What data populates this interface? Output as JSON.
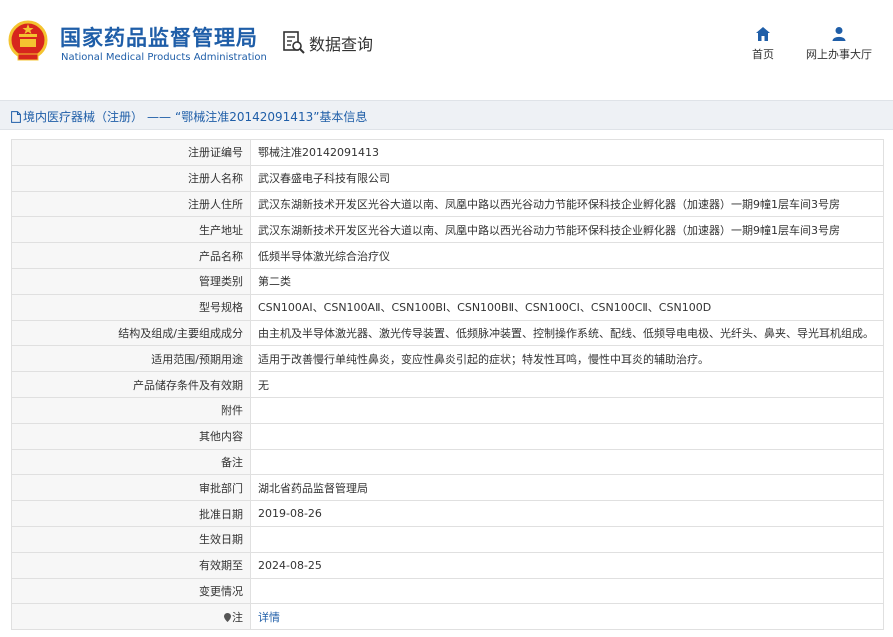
{
  "header": {
    "title_cn": "国家药品监督管理局",
    "title_en": "National Medical Products Administration",
    "query_label": "数据查询",
    "nav": [
      {
        "label": "首页",
        "icon": "home-icon"
      },
      {
        "label": "网上办事大厅",
        "icon": "user-icon"
      }
    ]
  },
  "breadcrumb": {
    "category": "境内医疗器械（注册）",
    "separator": "——",
    "title": "“鄂械注准20142091413”基本信息"
  },
  "detail": {
    "rows": [
      {
        "label": "注册证编号",
        "value": "鄂械注准20142091413"
      },
      {
        "label": "注册人名称",
        "value": "武汉春盛电子科技有限公司"
      },
      {
        "label": "注册人住所",
        "value": "武汉东湖新技术开发区光谷大道以南、凤凰中路以西光谷动力节能环保科技企业孵化器（加速器）一期9幢1层车间3号房"
      },
      {
        "label": "生产地址",
        "value": "武汉东湖新技术开发区光谷大道以南、凤凰中路以西光谷动力节能环保科技企业孵化器（加速器）一期9幢1层车间3号房"
      },
      {
        "label": "产品名称",
        "value": "低频半导体激光综合治疗仪"
      },
      {
        "label": "管理类别",
        "value": "第二类"
      },
      {
        "label": "型号规格",
        "value": "CSN100AⅠ、CSN100AⅡ、CSN100BⅠ、CSN100BⅡ、CSN100CⅠ、CSN100CⅡ、CSN100D"
      },
      {
        "label": "结构及组成/主要组成成分",
        "value": "由主机及半导体激光器、激光传导装置、低频脉冲装置、控制操作系统、配线、低频导电电极、光纤头、鼻夹、导光耳机组成。"
      },
      {
        "label": "适用范围/预期用途",
        "value": "适用于改善慢行单纯性鼻炎，变应性鼻炎引起的症状；特发性耳鸣，慢性中耳炎的辅助治疗。"
      },
      {
        "label": "产品储存条件及有效期",
        "value": "无"
      },
      {
        "label": "附件",
        "value": ""
      },
      {
        "label": "其他内容",
        "value": ""
      },
      {
        "label": "备注",
        "value": ""
      },
      {
        "label": "审批部门",
        "value": "湖北省药品监督管理局"
      },
      {
        "label": "批准日期",
        "value": "2019-08-26"
      },
      {
        "label": "生效日期",
        "value": ""
      },
      {
        "label": "有效期至",
        "value": "2024-08-25"
      },
      {
        "label": "变更情况",
        "value": ""
      }
    ],
    "note_label": "注",
    "note_link": "详情"
  },
  "colors": {
    "brand_blue": "#1f5ea8",
    "emblem_red": "#d7261d",
    "emblem_gold": "#f4c430"
  }
}
